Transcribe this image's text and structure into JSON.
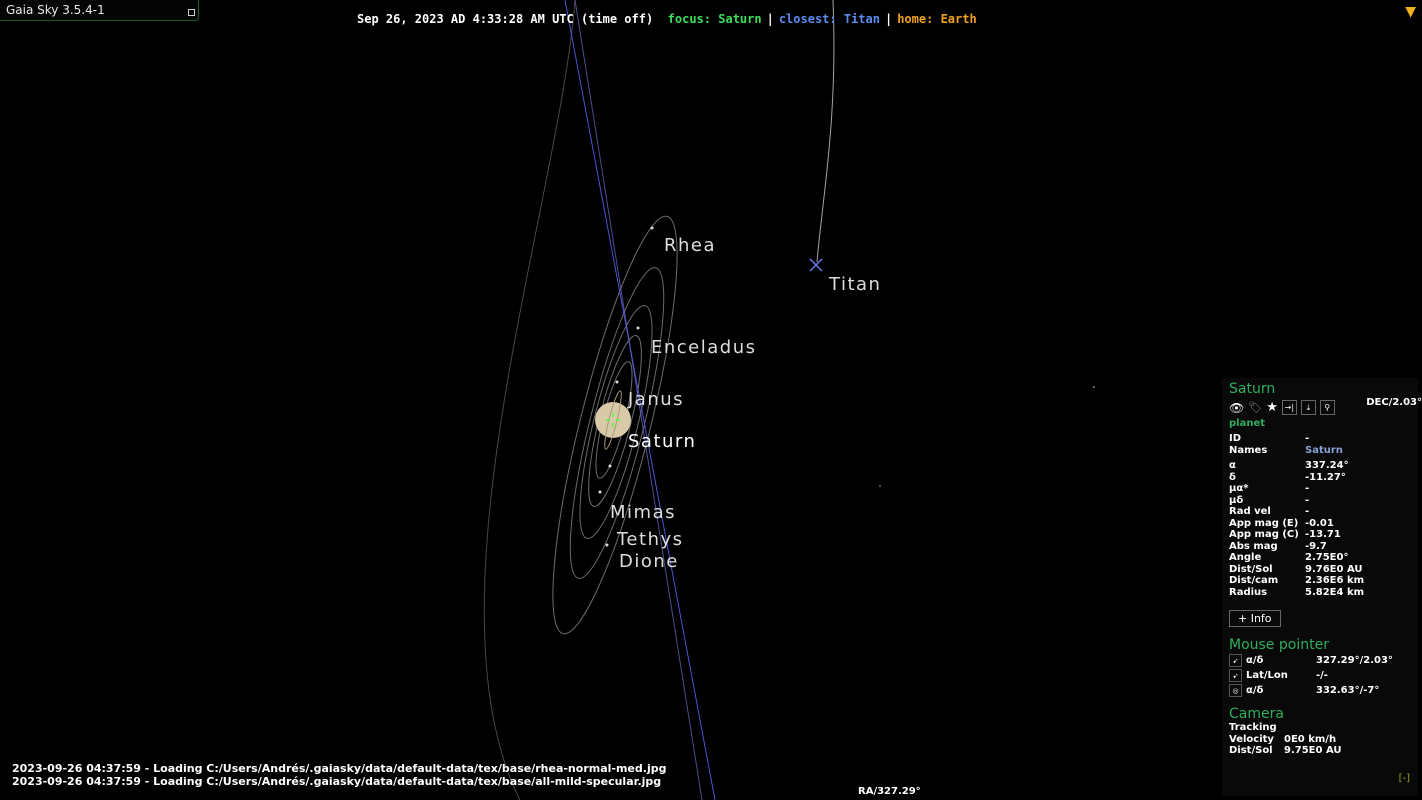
{
  "window": {
    "title": "Gaia Sky 3.5.4-1"
  },
  "status": {
    "datetime": "Sep 26, 2023 AD 4:33:28 AM UTC (time off)",
    "focus": "focus: Saturn",
    "closest": "closest: Titan",
    "home": "home: Earth",
    "focus_color": "#3ddc5a",
    "closest_color": "#5a8cf0",
    "home_color": "#f0a020"
  },
  "labels": {
    "rhea": "Rhea",
    "titan": "Titan",
    "enceladus": "Enceladus",
    "janus": "Janus",
    "saturn": "Saturn",
    "mimas": "Mimas",
    "tethys": "Tethys",
    "dione": "Dione"
  },
  "log": [
    "2023-09-26 04:37:59 - Loading C:/Users/Andrés/.gaiasky/data/default-data/tex/base/rhea-normal-med.jpg",
    "2023-09-26 04:37:59 - Loading C:/Users/Andrés/.gaiasky/data/default-data/tex/base/all-mild-specular.jpg"
  ],
  "coords": {
    "ra": "RA/327.29°",
    "dec": "DEC/2.03°"
  },
  "focus_panel": {
    "name": "Saturn",
    "type": "planet",
    "icons": [
      "eye-icon",
      "tag-icon",
      "star-icon",
      "go-to-icon",
      "land-on-icon",
      "land-at-icon"
    ],
    "rows": [
      [
        "ID",
        "-"
      ],
      [
        "Names",
        "Saturn"
      ],
      [
        "α",
        "337.24°"
      ],
      [
        "δ",
        "-11.27°"
      ],
      [
        "μα*",
        "-"
      ],
      [
        "μδ",
        "-"
      ],
      [
        "Rad vel",
        "-"
      ],
      [
        "App mag (E)",
        "-0.01"
      ],
      [
        "App mag (C)",
        "-13.71"
      ],
      [
        "Abs mag",
        "-9.7"
      ],
      [
        "Angle",
        "2.75E0°"
      ],
      [
        "Dist/Sol",
        "9.76E0 AU"
      ],
      [
        "Dist/cam",
        "2.36E6 km"
      ],
      [
        "Radius",
        "5.82E4 km"
      ]
    ],
    "info_button": "+ Info"
  },
  "mouse_pointer": {
    "title": "Mouse pointer",
    "rows": [
      [
        "α/δ",
        "327.29°/2.03°"
      ],
      [
        "Lat/Lon",
        "-/-"
      ],
      [
        "α/δ",
        "332.63°/-7°"
      ]
    ]
  },
  "camera": {
    "title": "Camera",
    "rows": [
      [
        "Tracking",
        ""
      ],
      [
        "Velocity",
        "0E0 km/h"
      ],
      [
        "Dist/Sol",
        "9.75E0 AU"
      ]
    ],
    "collapse": "[-]"
  }
}
